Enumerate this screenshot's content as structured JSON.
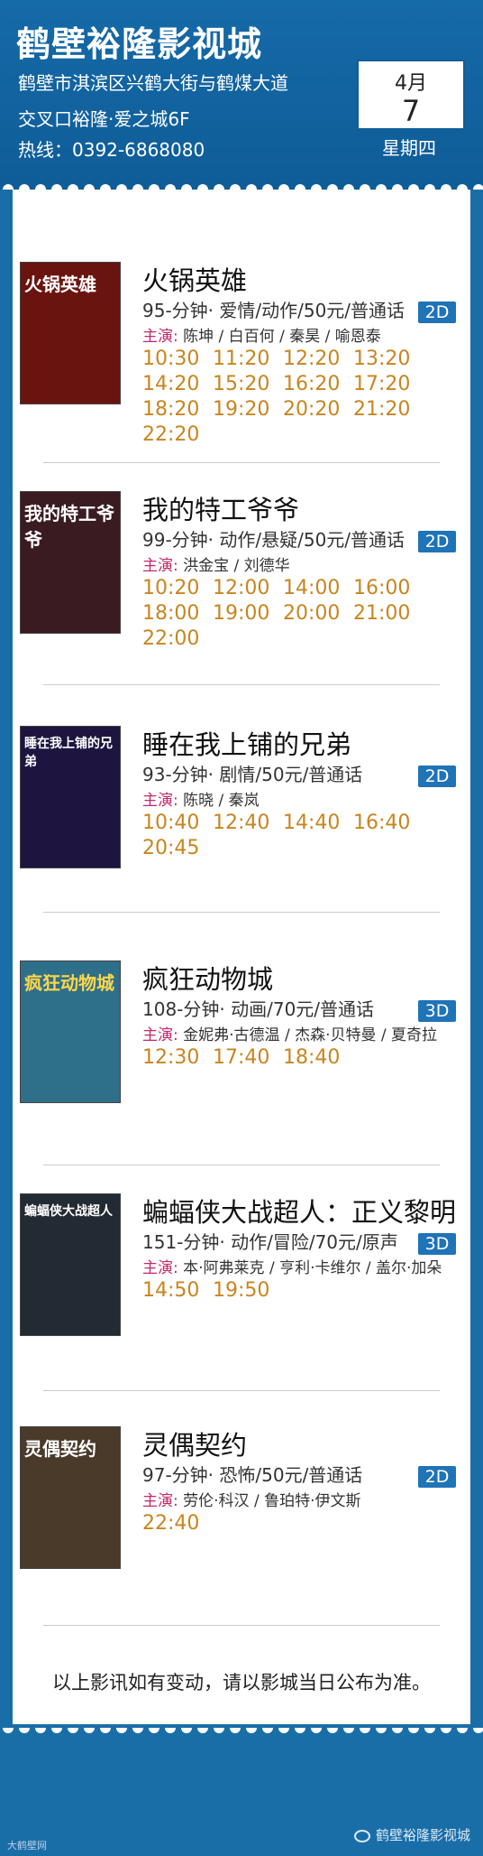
{
  "header": {
    "cinema_name": "鹤壁裕隆影视城",
    "address_line1": "鹤壁市淇滨区兴鹤大街与鹤煤大道",
    "address_line2": "交叉口裕隆·爱之城6F",
    "hotline": "热线：0392-6868080",
    "date": {
      "month": "4月",
      "day": "7",
      "weekday": "星期四"
    }
  },
  "cast_label": "主演:",
  "movies": [
    {
      "title": "火锅英雄",
      "info": "95-分钟· 爱情/动作/50元/普通话",
      "format": "2D",
      "cast": "陈坤 / 白百何 / 秦昊 / 喻恩泰",
      "poster_text": "火锅英雄",
      "poster_color": "#6a1410",
      "times": [
        "10:30",
        "11:20",
        "12:20",
        "13:20",
        "14:20",
        "15:20",
        "16:20",
        "17:20",
        "18:20",
        "19:20",
        "20:20",
        "21:20",
        "22:20"
      ]
    },
    {
      "title": "我的特工爷爷",
      "info": "99-分钟· 动作/悬疑/50元/普通话",
      "format": "2D",
      "cast": "洪金宝 / 刘德华",
      "poster_text": "我的特工爷爷",
      "poster_color": "#3a1b22",
      "times": [
        "10:20",
        "12:00",
        "14:00",
        "16:00",
        "18:00",
        "19:00",
        "20:00",
        "21:00",
        "22:00"
      ]
    },
    {
      "title": "睡在我上铺的兄弟",
      "info": "93-分钟· 剧情/50元/普通话",
      "format": "2D",
      "cast": "陈晓 / 秦岚",
      "poster_text": "睡在我上铺的兄弟",
      "poster_color": "#1d1540",
      "times": [
        "10:40",
        "12:40",
        "14:40",
        "16:40",
        "20:45"
      ]
    },
    {
      "title": "疯狂动物城",
      "info": "108-分钟· 动画/70元/普通话",
      "format": "3D",
      "cast": "金妮弗·古德温 / 杰森·贝特曼 / 夏奇拉",
      "poster_text": "疯狂动物城",
      "poster_color": "#2e6f8a",
      "times": [
        "12:30",
        "17:40",
        "18:40"
      ]
    },
    {
      "title": "蝙蝠侠大战超人：正义黎明",
      "info": "151-分钟· 动作/冒险/70元/原声",
      "format": "3D",
      "cast": "本·阿弗莱克 / 亨利·卡维尔 / 盖尔·加朵",
      "poster_text": "蝙蝠侠大战超人",
      "poster_color": "#222a33",
      "times": [
        "14:50",
        "19:50"
      ]
    },
    {
      "title": "灵偶契约",
      "info": "97-分钟· 恐怖/50元/普通话",
      "format": "2D",
      "cast": "劳伦·科汉 / 鲁珀特·伊文斯",
      "poster_text": "灵偶契约",
      "poster_color": "#4a3a2a",
      "times": [
        "22:40"
      ]
    }
  ],
  "notice": "以上影讯如有变动，请以影城当日公布为准。",
  "footer": {
    "brand": "鹤壁裕隆影视城",
    "source": "大鹤壁网"
  }
}
